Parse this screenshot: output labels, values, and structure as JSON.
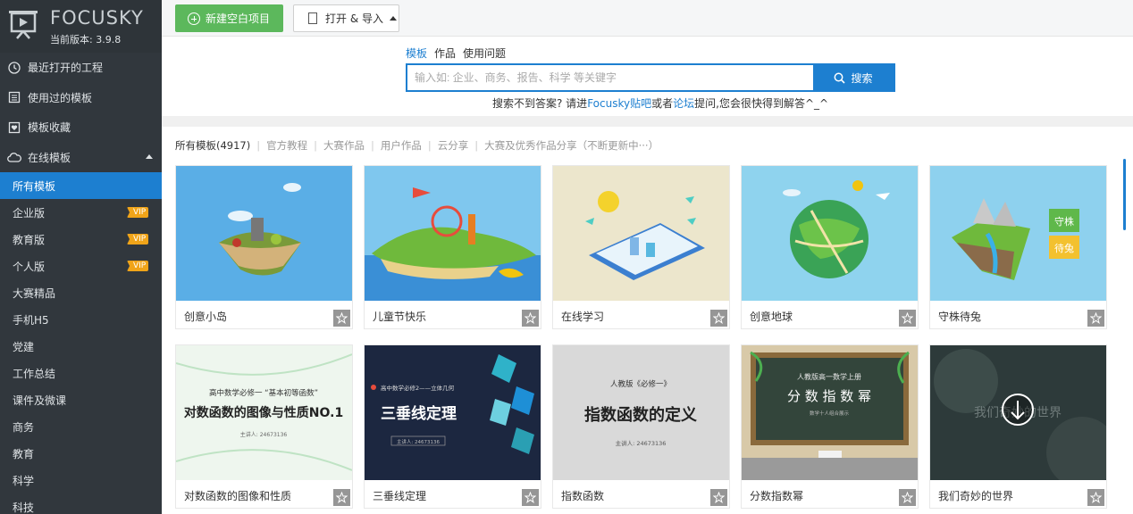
{
  "brand": {
    "name": "FOCUSKY",
    "version": "当前版本: 3.9.8"
  },
  "nav": {
    "items": [
      {
        "label": "最近打开的工程",
        "icon": "clock-icon"
      },
      {
        "label": "使用过的模板",
        "icon": "template-list-icon"
      },
      {
        "label": "模板收藏",
        "icon": "favorite-box-icon"
      },
      {
        "label": "在线模板",
        "icon": "cloud-icon"
      }
    ],
    "sub_items": [
      {
        "label": "所有模板",
        "active": true,
        "vip": ""
      },
      {
        "label": "企业版",
        "vip": "VIP"
      },
      {
        "label": "教育版",
        "vip": "VIP"
      },
      {
        "label": "个人版",
        "vip": "VIP"
      },
      {
        "label": "大赛精品",
        "vip": ""
      },
      {
        "label": "手机H5",
        "vip": ""
      },
      {
        "label": "党建",
        "vip": ""
      },
      {
        "label": "工作总结",
        "vip": ""
      },
      {
        "label": "课件及微课",
        "vip": ""
      },
      {
        "label": "商务",
        "vip": ""
      },
      {
        "label": "教育",
        "vip": ""
      },
      {
        "label": "科学",
        "vip": ""
      },
      {
        "label": "科技",
        "vip": ""
      }
    ]
  },
  "toolbar": {
    "new_label": "新建空白项目",
    "open_label": "打开 & 导入"
  },
  "search": {
    "tabs": [
      "模板",
      "作品",
      "使用问题"
    ],
    "placeholder": "输入如: 企业、商务、报告、科学 等关键字",
    "value": "",
    "button_label": "搜索",
    "hint_prefix": "搜索不到答案? 请进",
    "hint_link1": "Focusky贴吧",
    "hint_mid": "或者",
    "hint_link2": "论坛",
    "hint_suffix": "提问,您会很快得到解答^_^"
  },
  "filters": [
    "所有模板(4917)",
    "官方教程",
    "大赛作品",
    "用户作品",
    "云分享",
    "大赛及优秀作品分享（不断更新中···）"
  ],
  "templates": [
    {
      "label": "创意小岛",
      "bg": "#5aaee6"
    },
    {
      "label": "儿童节快乐",
      "bg": "#7fc7ee"
    },
    {
      "label": "在线学习",
      "bg": "#ece6cc"
    },
    {
      "label": "创意地球",
      "bg": "#8fd3ee"
    },
    {
      "label": "守株待兔",
      "bg": "#8ed1ee",
      "tag1": "守株",
      "tag2": "待兔"
    },
    {
      "label": "对数函数的图像和性质",
      "bg": "#eef6ee",
      "sub": "高中数学必修一 “基本初等函数”",
      "big": "对数函数的图像与性质NO.1",
      "small": "主讲人: 24673136"
    },
    {
      "label": "三垂线定理",
      "bg": "#1c2740",
      "sub": "高中数学必修2——立体几何",
      "big": "三垂线定理",
      "small": "主讲人: 24673136"
    },
    {
      "label": "指数函数",
      "bg": "#d9d9d9",
      "sub": "人教版《必修一》",
      "big": "指数函数的定义",
      "small": "主讲人: 24673136"
    },
    {
      "label": "分数指数幂",
      "bg": "#3b4a43",
      "sub": "人教版高一数学上册",
      "big": "分 数 指 数 幂",
      "small": "数学十人组合展示"
    },
    {
      "label": "我们奇妙的世界",
      "bg": "#2d3a3a",
      "big": "我们奇妙的世界"
    }
  ]
}
